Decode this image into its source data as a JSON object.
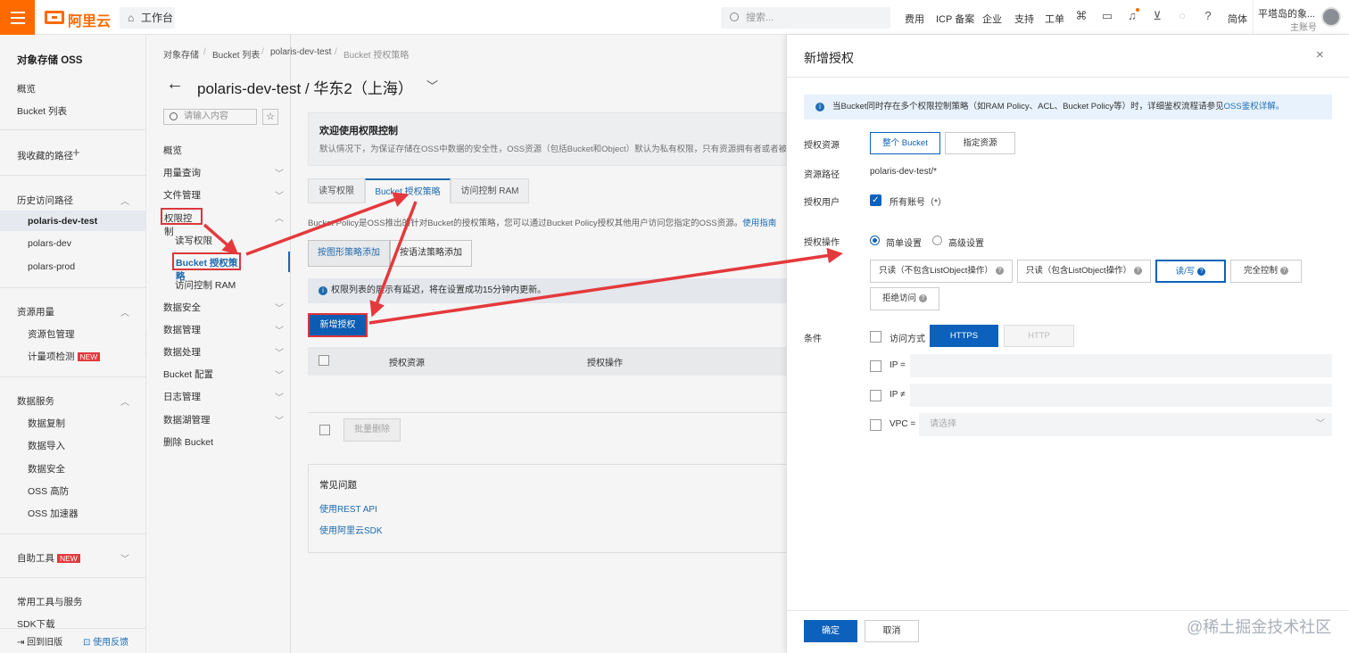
{
  "topbar": {
    "logo": "阿里云",
    "workbench": "工作台",
    "search_placeholder": "搜索...",
    "nav": [
      "费用",
      "ICP 备案",
      "企业",
      "支持",
      "工单"
    ],
    "lang": "简体",
    "user_name": "平塔岛的象...",
    "user_role": "主账号"
  },
  "sidebar": {
    "title": "对象存储 OSS",
    "overview": "概览",
    "bucket_list": "Bucket 列表",
    "favorites": "我收藏的路径",
    "history": "历史访问路径",
    "history_items": [
      "polaris-dev-test",
      "polars-dev",
      "polars-prod"
    ],
    "resource_usage": "资源用量",
    "resource_items": [
      "资源包管理",
      "计量项检测"
    ],
    "new_badge": "NEW",
    "data_services": "数据服务",
    "data_items": [
      "数据复制",
      "数据导入",
      "数据安全",
      "OSS 高防",
      "OSS 加速器"
    ],
    "self_tools": "自助工具",
    "common_tools": "常用工具与服务",
    "sdk": "SDK下载",
    "back_old": "回到旧版",
    "feedback": "使用反馈"
  },
  "nav2": {
    "search_placeholder": "请输入内容",
    "items": [
      "概览",
      "用量查询",
      "文件管理",
      "权限控制"
    ],
    "sub_items": [
      "读写权限",
      "Bucket 授权策略",
      "访问控制 RAM"
    ],
    "items2": [
      "数据安全",
      "数据管理",
      "数据处理",
      "Bucket 配置",
      "日志管理",
      "数据湖管理",
      "删除 Bucket"
    ]
  },
  "main": {
    "breadcrumb": [
      "对象存储",
      "Bucket 列表",
      "polaris-dev-test",
      "Bucket 授权策略"
    ],
    "title": "polaris-dev-test / 华东2（上海）",
    "welcome_title": "欢迎使用权限控制",
    "welcome_desc": "默认情况下，为保证存储在OSS中数据的安全性，OSS资源（包括Bucket和Object）默认为私有权限，只有资源拥有者或者被授",
    "tabs": [
      "读写权限",
      "Bucket 授权策略",
      "访问控制 RAM"
    ],
    "policy_desc": "Bucket Policy是OSS推出的针对Bucket的授权策略，您可以通过Bucket Policy授权其他用户访问您指定的OSS资源。",
    "policy_link": "使用指南",
    "btn_graphic": "按图形策略添加",
    "btn_syntax": "按语法策略添加",
    "notice": "权限列表的展示有延迟，将在设置成功15分钟内更新。",
    "btn_new": "新增授权",
    "col_resource": "授权资源",
    "col_action": "授权操作",
    "btn_batch_delete": "批量删除",
    "faq_title": "常见问题",
    "faq_links": [
      "使用REST API",
      "使用阿里云SDK"
    ]
  },
  "drawer": {
    "title": "新增授权",
    "info": "当Bucket同时存在多个权限控制策略（如RAM Policy、ACL、Bucket Policy等）时，详细鉴权流程请参见",
    "info_link": "OSS鉴权详解。",
    "label_resource": "授权资源",
    "res_options": [
      "整个 Bucket",
      "指定资源"
    ],
    "label_path": "资源路径",
    "path_value": "polaris-dev-test/*",
    "label_user": "授权用户",
    "all_accounts": "所有账号（*）",
    "label_action": "授权操作",
    "mode_simple": "简单设置",
    "mode_advanced": "高级设置",
    "actions": [
      "只读（不包含ListObject操作）",
      "只读（包含ListObject操作）",
      "读/写",
      "完全控制",
      "拒绝访问"
    ],
    "label_cond": "条件",
    "access_method": "访问方式",
    "https": "HTTPS",
    "http": "HTTP",
    "ip_eq": "IP =",
    "ip_ne": "IP ≠",
    "vpc": "VPC =",
    "vpc_placeholder": "请选择",
    "ok": "确定",
    "cancel": "取消"
  },
  "watermark": "@稀土掘金技术社区"
}
